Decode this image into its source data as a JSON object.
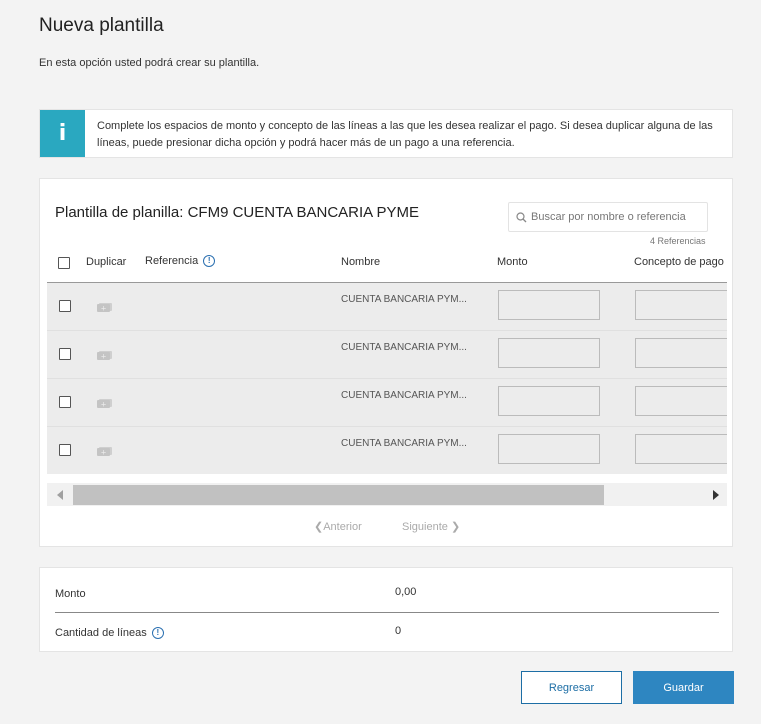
{
  "page": {
    "title": "Nueva plantilla",
    "subtitle": "En esta opción usted podrá crear su plantilla."
  },
  "info": {
    "icon": "info-icon",
    "text": "Complete los espacios de monto y concepto de las líneas a las que les desea realizar el pago. Si desea duplicar alguna de las líneas, puede presionar dicha opción y podrá hacer más de un pago a una referencia."
  },
  "card": {
    "title": "Plantilla de planilla: CFM9 CUENTA BANCARIA PYME",
    "search_placeholder": "Buscar por nombre o referencia",
    "ref_count": "4 Referencias"
  },
  "table": {
    "headers": {
      "duplicar": "Duplicar",
      "referencia": "Referencia",
      "nombre": "Nombre",
      "monto": "Monto",
      "concepto": "Concepto de pago"
    },
    "rows": [
      {
        "referencia": "",
        "nombre": "CUENTA BANCARIA PYM...",
        "monto": "",
        "concepto": ""
      },
      {
        "referencia": "",
        "nombre": "CUENTA BANCARIA PYM...",
        "monto": "",
        "concepto": ""
      },
      {
        "referencia": "",
        "nombre": "CUENTA BANCARIA PYM...",
        "monto": "",
        "concepto": ""
      },
      {
        "referencia": "",
        "nombre": "CUENTA BANCARIA PYM...",
        "monto": "",
        "concepto": ""
      }
    ]
  },
  "pagination": {
    "prev": "Anterior",
    "next": "Siguiente"
  },
  "summary": {
    "monto_label": "Monto",
    "monto_value": "0,00",
    "lineas_label": "Cantidad de líneas",
    "lineas_value": "0"
  },
  "actions": {
    "back": "Regresar",
    "save": "Guardar"
  },
  "colors": {
    "accent": "#2aa8c0",
    "primary": "#2e86c1",
    "link": "#1d6ea5"
  }
}
